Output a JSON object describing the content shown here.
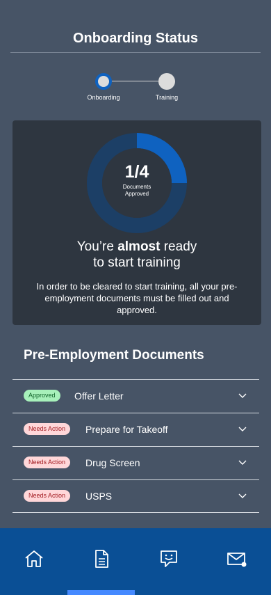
{
  "header": {
    "title": "Onboarding Status"
  },
  "stepper": {
    "steps": [
      {
        "label": "Onboarding",
        "state": "active"
      },
      {
        "label": "Training",
        "state": "upcoming"
      }
    ]
  },
  "status_card": {
    "count": "1/4",
    "caption": "Documents Approved",
    "progress_fraction": 0.25,
    "ready_prefix": "You’re ",
    "ready_bold": "almost",
    "ready_suffix": " ready",
    "ready_line2": "to start training",
    "note": "In order to be cleared to start training, all your pre-employment documents must be filled out and approved."
  },
  "documents": {
    "title": "Pre-Employment Documents",
    "items": [
      {
        "status": "Approved",
        "name": "Offer Letter"
      },
      {
        "status": "Needs Action",
        "name": "Prepare for Takeoff"
      },
      {
        "status": "Needs Action",
        "name": "Drug Screen"
      },
      {
        "status": "Needs Action",
        "name": "USPS"
      }
    ]
  },
  "bottom_nav": {
    "items": [
      {
        "icon": "home-icon"
      },
      {
        "icon": "document-icon",
        "selected": true
      },
      {
        "icon": "chat-bot-icon"
      },
      {
        "icon": "mail-icon"
      }
    ]
  },
  "colors": {
    "background": "#475466",
    "card": "#2e3640",
    "accent": "#0f62c0",
    "nav": "#0a4f95",
    "approved_badge": "#a7f0ba",
    "action_badge": "#ffd7d9"
  }
}
